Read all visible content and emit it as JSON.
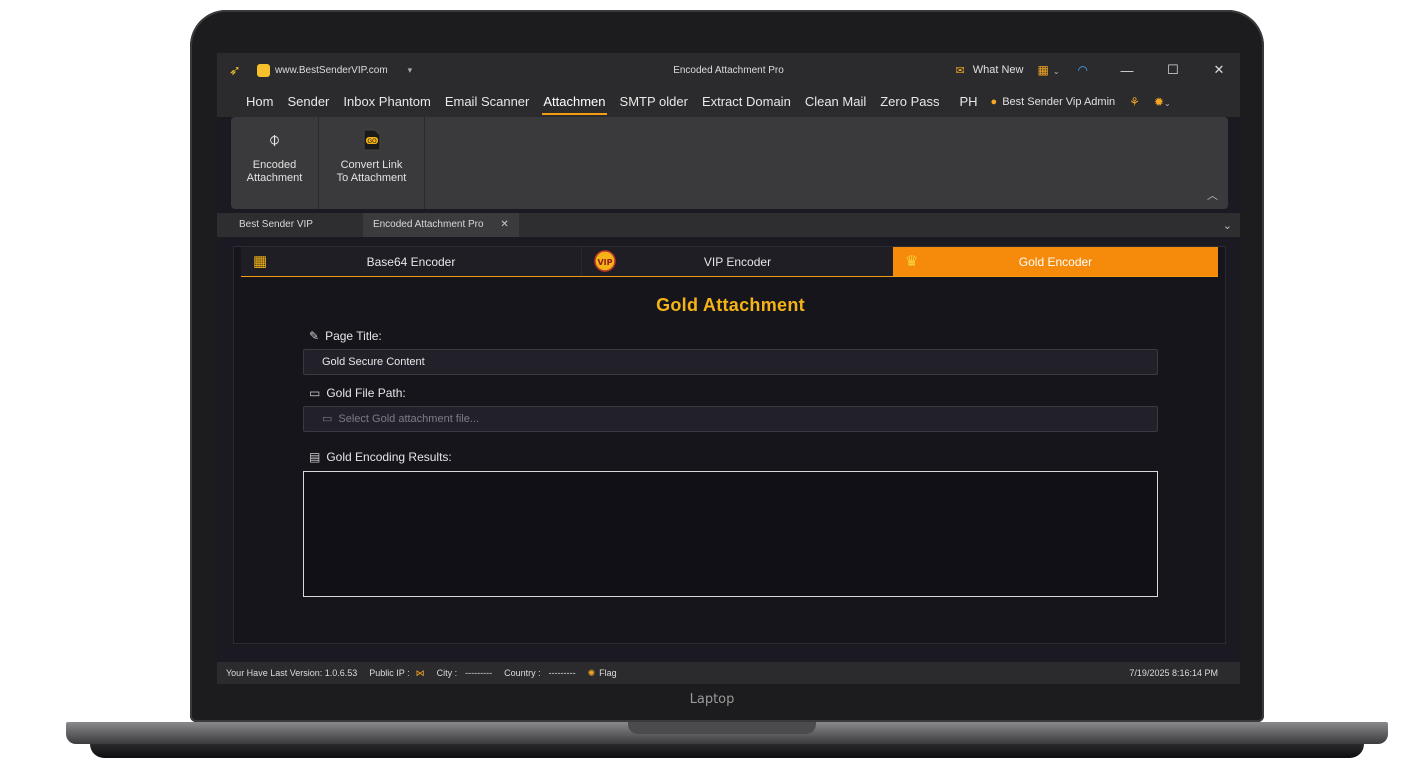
{
  "device": {
    "label": "Laptop"
  },
  "titlebar": {
    "site": "www.BestSenderVIP.com",
    "window_title": "Encoded Attachment Pro",
    "whats_new": "What New",
    "minimize": "—",
    "maximize": "☐",
    "close": "✕"
  },
  "menu": {
    "items": [
      "Hom",
      "Sender",
      "Inbox Phantom",
      "Email Scanner",
      "Attachmen",
      "SMTP older",
      "Extract Domain",
      "Clean Mail",
      "Zero Pass",
      "PH"
    ],
    "active": "Attachmen",
    "user": "Best Sender Vip Admin"
  },
  "ribbon": {
    "buttons": [
      {
        "label_line1": "Encoded",
        "label_line2": "Attachment",
        "icon": "paperclip-icon"
      },
      {
        "label_line1": "Convert Link",
        "label_line2": "To Attachment",
        "icon": "link-file-icon"
      }
    ]
  },
  "doc_tabs": {
    "home": "Best Sender VIP",
    "active": "Encoded Attachment Pro"
  },
  "encoder_tabs": [
    {
      "label": "Base64 Encoder",
      "icon": "base64-lock-icon",
      "active": false
    },
    {
      "label": "VIP Encoder",
      "icon": "vip-badge-icon",
      "active": false
    },
    {
      "label": "Gold Encoder",
      "icon": "crown-icon",
      "active": true
    }
  ],
  "form": {
    "heading": "Gold Attachment",
    "page_title_label": "Page Title:",
    "page_title_value": "Gold Secure Content",
    "file_path_label": "Gold File Path:",
    "file_path_placeholder": "Select Gold attachment file...",
    "results_label": "Gold Encoding Results:",
    "results_value": ""
  },
  "status": {
    "version": "Your Have Last Version: 1.0.6.53",
    "public_ip_label": "Public IP :",
    "city_label": "City :",
    "city_value": "---------",
    "country_label": "Country :",
    "country_value": "---------",
    "flag_label": "Flag",
    "datetime": "7/19/2025 8:16:14 PM"
  },
  "colors": {
    "accent": "#f58a0b",
    "heading": "#f5b416",
    "background": "#16151c",
    "chrome": "#2b2b2d"
  }
}
